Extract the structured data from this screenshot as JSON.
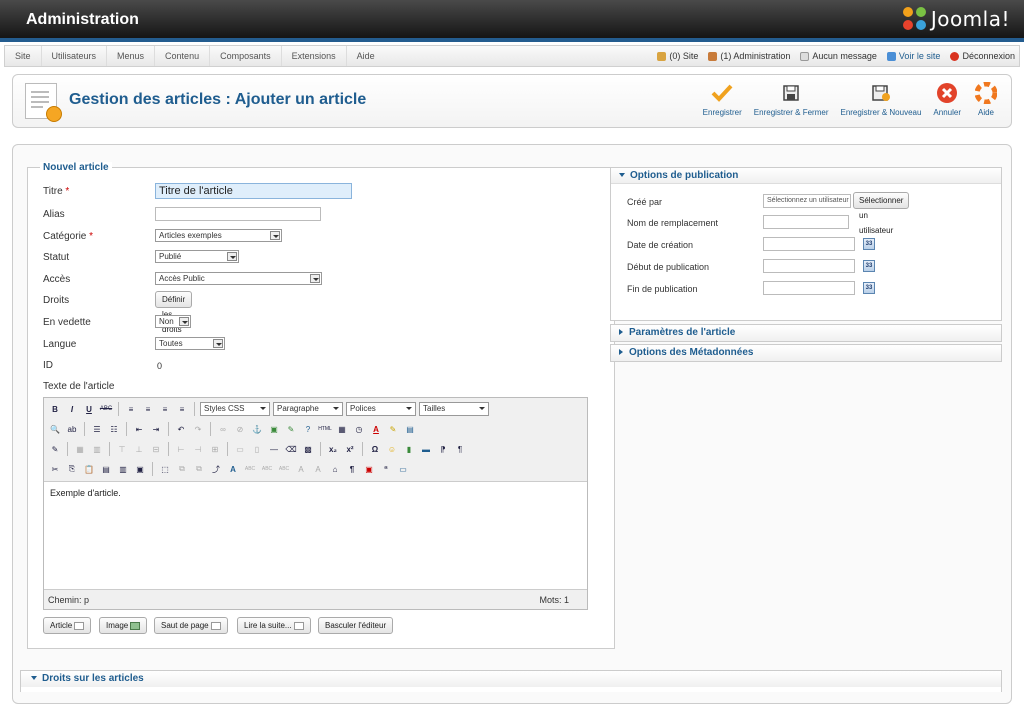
{
  "header": {
    "title": "Administration",
    "brand": "Joomla!"
  },
  "menu": [
    "Site",
    "Utilisateurs",
    "Menus",
    "Contenu",
    "Composants",
    "Extensions",
    "Aide"
  ],
  "status": {
    "site": "(0) Site",
    "admin": "(1) Administration",
    "messages": "Aucun message",
    "view_site": "Voir le site",
    "logout": "Déconnexion"
  },
  "page": {
    "title": "Gestion des articles : Ajouter un article"
  },
  "toolbar": {
    "save": "Enregistrer",
    "save_close": "Enregistrer & Fermer",
    "save_new": "Enregistrer & Nouveau",
    "cancel": "Annuler",
    "help": "Aide"
  },
  "form": {
    "legend": "Nouvel article",
    "title_label": "Titre",
    "title_value": "Titre de l'article",
    "alias_label": "Alias",
    "alias_value": "",
    "category_label": "Catégorie",
    "category_value": "Articles exemples",
    "status_label": "Statut",
    "status_value": "Publié",
    "access_label": "Accès",
    "access_value": "Accès Public",
    "rights_label": "Droits",
    "rights_button": "Définir les droits",
    "featured_label": "En vedette",
    "featured_value": "Non",
    "language_label": "Langue",
    "language_value": "Toutes",
    "id_label": "ID",
    "id_value": "0",
    "text_label": "Texte de l'article"
  },
  "editor": {
    "styles": "Styles CSS",
    "format": "Paragraphe",
    "fonts": "Polices",
    "sizes": "Tailles",
    "content": "Exemple d'article.",
    "path": "Chemin: p",
    "words": "Mots: 1"
  },
  "editor_buttons": {
    "article": "Article",
    "image": "Image",
    "pagebreak": "Saut de page",
    "readmore": "Lire la suite...",
    "toggle": "Basculer l'éditeur"
  },
  "publishing": {
    "title": "Options de publication",
    "created_by_label": "Créé par",
    "created_by_placeholder": "Sélectionnez un utilisateur",
    "select_user_button": "Sélectionner un utilisateur",
    "alias_name_label": "Nom de remplacement",
    "created_date_label": "Date de création",
    "publish_up_label": "Début de publication",
    "publish_down_label": "Fin de publication"
  },
  "collapsed_panels": {
    "params": "Paramètres de l'article",
    "metadata": "Options des Métadonnées"
  },
  "rights_section": {
    "title": "Droits sur les articles"
  }
}
